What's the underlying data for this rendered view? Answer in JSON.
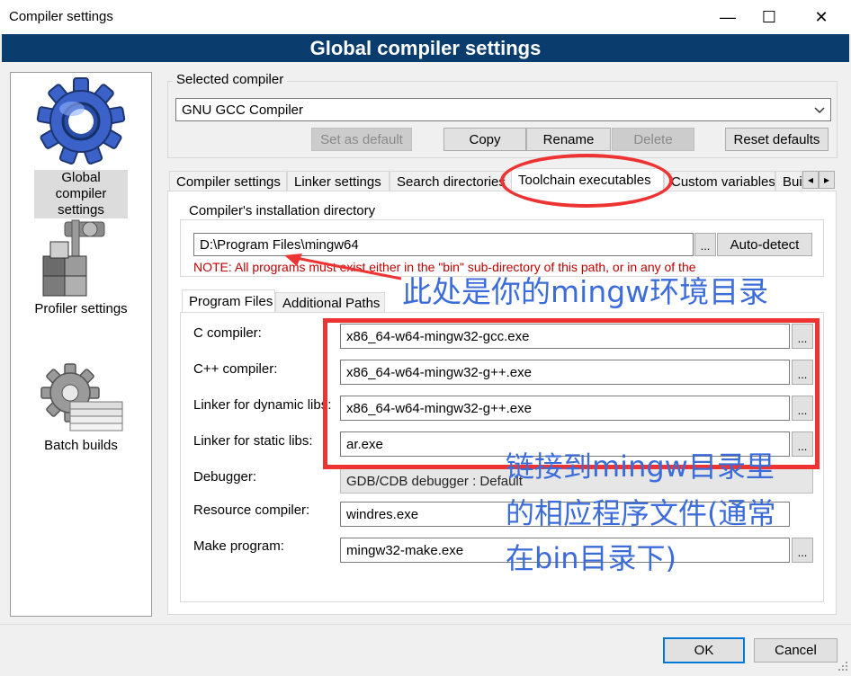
{
  "window": {
    "title": "Compiler settings",
    "controls": {
      "minimize": "—",
      "maximize": "☐",
      "close": "✕"
    }
  },
  "banner": "Global compiler settings",
  "sidebar": {
    "items": [
      {
        "label": "Global compiler settings",
        "icon": "gear-icon",
        "selected": true
      },
      {
        "label": "Profiler settings",
        "icon": "profiler-icon",
        "selected": false
      },
      {
        "label": "Batch builds",
        "icon": "batch-builds-icon",
        "selected": false
      }
    ]
  },
  "selected_compiler": {
    "group_title": "Selected compiler",
    "value": "GNU GCC Compiler",
    "buttons": {
      "set_default": "Set as default",
      "copy": "Copy",
      "rename": "Rename",
      "delete": "Delete",
      "reset_defaults": "Reset defaults"
    }
  },
  "tabs": [
    {
      "label": "Compiler settings",
      "active": false
    },
    {
      "label": "Linker settings",
      "active": false
    },
    {
      "label": "Search directories",
      "active": false
    },
    {
      "label": "Toolchain executables",
      "active": true
    },
    {
      "label": "Custom variables",
      "active": false
    },
    {
      "label": "Bui",
      "active": false
    }
  ],
  "tab_scroll": {
    "left": "◂",
    "right": "▸"
  },
  "install_dir": {
    "group_title": "Compiler's installation directory",
    "value": "D:\\Program Files\\mingw64",
    "browse": "...",
    "auto_detect": "Auto-detect",
    "note": "NOTE: All programs must exist either in the \"bin\" sub-directory of this path, or in any of the"
  },
  "subtabs": [
    {
      "label": "Program Files",
      "active": true
    },
    {
      "label": "Additional Paths",
      "active": false
    }
  ],
  "programs": {
    "c_compiler": {
      "label": "C compiler:",
      "value": "x86_64-w64-mingw32-gcc.exe"
    },
    "cpp_compiler": {
      "label": "C++ compiler:",
      "value": "x86_64-w64-mingw32-g++.exe"
    },
    "linker_dynamic": {
      "label": "Linker for dynamic libs:",
      "value": "x86_64-w64-mingw32-g++.exe"
    },
    "linker_static": {
      "label": "Linker for static libs:",
      "value": "ar.exe"
    },
    "debugger": {
      "label": "Debugger:",
      "value": "GDB/CDB debugger : Default"
    },
    "resource_compiler": {
      "label": "Resource compiler:",
      "value": "windres.exe"
    },
    "make_program": {
      "label": "Make program:",
      "value": "mingw32-make.exe"
    },
    "browse": "..."
  },
  "footer": {
    "ok": "OK",
    "cancel": "Cancel"
  },
  "annotations": {
    "env_dir": "此处是你的mingw环境目录",
    "link_line1": "链接到mingw目录里",
    "link_line2": "的相应程序文件(通常",
    "link_line3": "在bin目录下)",
    "color": "#ee3333",
    "text_color": "#3c6cd9"
  },
  "colors": {
    "banner": "#0b3c6e",
    "accent": "#0078d7"
  }
}
